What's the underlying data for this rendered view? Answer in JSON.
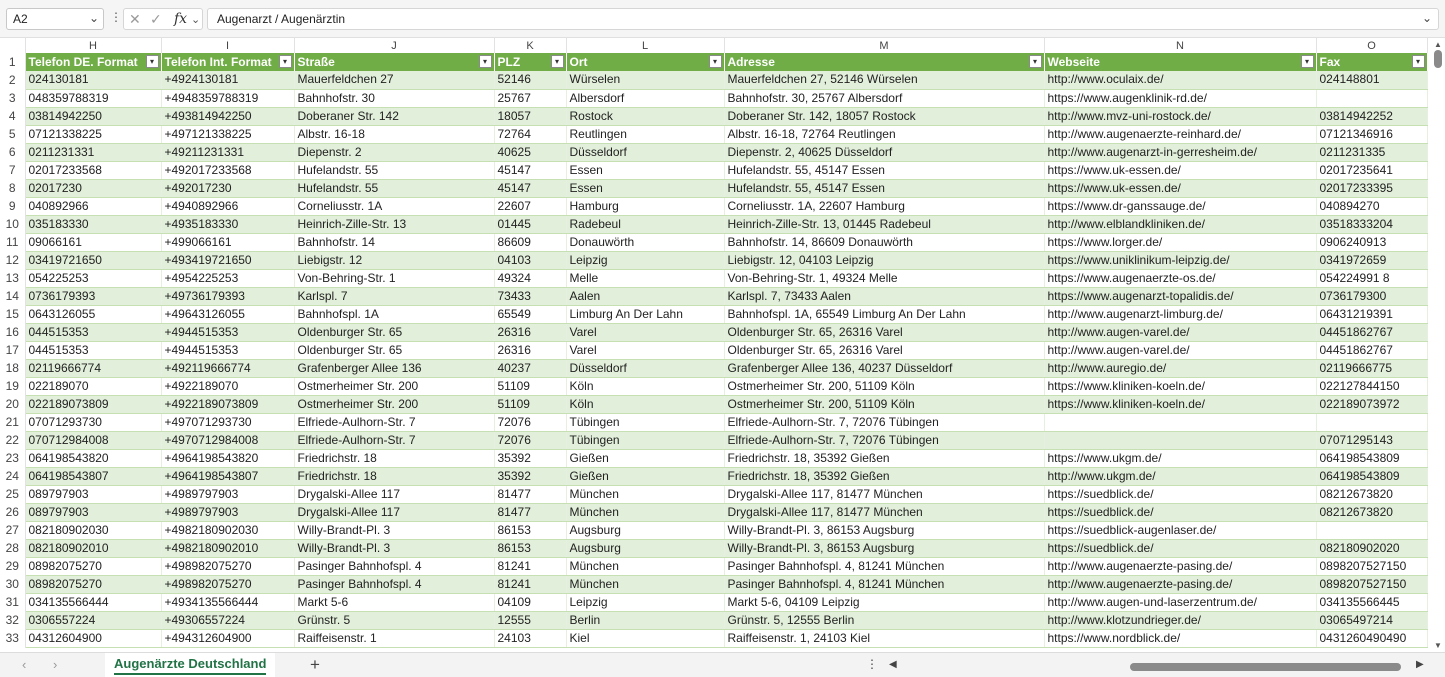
{
  "formula_bar": {
    "name_box": "A2",
    "fx_label": "fx",
    "cancel_glyph": "✕",
    "confirm_glyph": "✓",
    "formula": "Augenarzt / Augenärztin"
  },
  "grid": {
    "column_letters": [
      "H",
      "I",
      "J",
      "K",
      "L",
      "M",
      "N",
      "O"
    ],
    "headers": [
      "Telefon DE. Format",
      "Telefon Int. Format",
      "Straße",
      "PLZ",
      "Ort",
      "Adresse",
      "Webseite",
      "Fax"
    ],
    "filter_glyph": "▾",
    "header_row_number": "1",
    "rows": [
      {
        "n": "2",
        "c": [
          "024130181",
          "+4924130181",
          "Mauerfeldchen 27",
          "52146",
          "Würselen",
          "Mauerfeldchen 27, 52146 Würselen",
          "http://www.oculaix.de/",
          "024148801"
        ]
      },
      {
        "n": "3",
        "c": [
          "048359788319",
          "+4948359788319",
          "Bahnhofstr. 30",
          "25767",
          "Albersdorf",
          "Bahnhofstr. 30, 25767 Albersdorf",
          "https://www.augenklinik-rd.de/",
          ""
        ]
      },
      {
        "n": "4",
        "c": [
          "03814942250",
          "+493814942250",
          "Doberaner Str. 142",
          "18057",
          "Rostock",
          "Doberaner Str. 142, 18057 Rostock",
          "http://www.mvz-uni-rostock.de/",
          "03814942252"
        ]
      },
      {
        "n": "5",
        "c": [
          "07121338225",
          "+497121338225",
          "Albstr. 16-18",
          "72764",
          "Reutlingen",
          "Albstr. 16-18, 72764 Reutlingen",
          "http://www.augenaerzte-reinhard.de/",
          "07121346916"
        ]
      },
      {
        "n": "6",
        "c": [
          "0211231331",
          "+49211231331",
          "Diepenstr. 2",
          "40625",
          "Düsseldorf",
          "Diepenstr. 2, 40625 Düsseldorf",
          "http://www.augenarzt-in-gerresheim.de/",
          "0211231335"
        ]
      },
      {
        "n": "7",
        "c": [
          "02017233568",
          "+492017233568",
          "Hufelandstr. 55",
          "45147",
          "Essen",
          "Hufelandstr. 55, 45147 Essen",
          "https://www.uk-essen.de/",
          "02017235641"
        ]
      },
      {
        "n": "8",
        "c": [
          "02017230",
          "+492017230",
          "Hufelandstr. 55",
          "45147",
          "Essen",
          "Hufelandstr. 55, 45147 Essen",
          "https://www.uk-essen.de/",
          "02017233395"
        ]
      },
      {
        "n": "9",
        "c": [
          "040892966",
          "+4940892966",
          "Corneliusstr. 1A",
          "22607",
          "Hamburg",
          "Corneliusstr. 1A, 22607 Hamburg",
          "https://www.dr-ganssauge.de/",
          "040894270"
        ]
      },
      {
        "n": "10",
        "c": [
          "035183330",
          "+4935183330",
          "Heinrich-Zille-Str. 13",
          "01445",
          "Radebeul",
          "Heinrich-Zille-Str. 13, 01445 Radebeul",
          "http://www.elblandkliniken.de/",
          "03518333204"
        ]
      },
      {
        "n": "11",
        "c": [
          "09066161",
          "+499066161",
          "Bahnhofstr. 14",
          "86609",
          "Donauwörth",
          "Bahnhofstr. 14, 86609 Donauwörth",
          "https://www.lorger.de/",
          "0906240913"
        ]
      },
      {
        "n": "12",
        "c": [
          "03419721650",
          "+493419721650",
          "Liebigstr. 12",
          "04103",
          "Leipzig",
          "Liebigstr. 12, 04103 Leipzig",
          "https://www.uniklinikum-leipzig.de/",
          "0341972659"
        ]
      },
      {
        "n": "13",
        "c": [
          "054225253",
          "+4954225253",
          "Von-Behring-Str. 1",
          "49324",
          "Melle",
          "Von-Behring-Str. 1, 49324 Melle",
          "https://www.augenaerzte-os.de/",
          "054224991 8"
        ]
      },
      {
        "n": "14",
        "c": [
          "0736179393",
          "+49736179393",
          "Karlspl. 7",
          "73433",
          "Aalen",
          "Karlspl. 7, 73433 Aalen",
          "https://www.augenarzt-topalidis.de/",
          "0736179300"
        ]
      },
      {
        "n": "15",
        "c": [
          "0643126055",
          "+49643126055",
          "Bahnhofspl. 1A",
          "65549",
          "Limburg An Der Lahn",
          "Bahnhofspl. 1A, 65549 Limburg An Der Lahn",
          "http://www.augenarzt-limburg.de/",
          "06431219391"
        ]
      },
      {
        "n": "16",
        "c": [
          "044515353",
          "+4944515353",
          "Oldenburger Str. 65",
          "26316",
          "Varel",
          "Oldenburger Str. 65, 26316 Varel",
          "http://www.augen-varel.de/",
          "04451862767"
        ]
      },
      {
        "n": "17",
        "c": [
          "044515353",
          "+4944515353",
          "Oldenburger Str. 65",
          "26316",
          "Varel",
          "Oldenburger Str. 65, 26316 Varel",
          "http://www.augen-varel.de/",
          "04451862767"
        ]
      },
      {
        "n": "18",
        "c": [
          "02119666774",
          "+492119666774",
          "Grafenberger Allee 136",
          "40237",
          "Düsseldorf",
          "Grafenberger Allee 136, 40237 Düsseldorf",
          "http://www.auregio.de/",
          "02119666775"
        ]
      },
      {
        "n": "19",
        "c": [
          "022189070",
          "+4922189070",
          "Ostmerheimer Str. 200",
          "51109",
          "Köln",
          "Ostmerheimer Str. 200, 51109 Köln",
          "https://www.kliniken-koeln.de/",
          "022127844150"
        ]
      },
      {
        "n": "20",
        "c": [
          "022189073809",
          "+4922189073809",
          "Ostmerheimer Str. 200",
          "51109",
          "Köln",
          "Ostmerheimer Str. 200, 51109 Köln",
          "https://www.kliniken-koeln.de/",
          "022189073972"
        ]
      },
      {
        "n": "21",
        "c": [
          "07071293730",
          "+497071293730",
          "Elfriede-Aulhorn-Str. 7",
          "72076",
          "Tübingen",
          "Elfriede-Aulhorn-Str. 7, 72076 Tübingen",
          "",
          ""
        ]
      },
      {
        "n": "22",
        "c": [
          "070712984008",
          "+4970712984008",
          "Elfriede-Aulhorn-Str. 7",
          "72076",
          "Tübingen",
          "Elfriede-Aulhorn-Str. 7, 72076 Tübingen",
          "",
          "07071295143"
        ]
      },
      {
        "n": "23",
        "c": [
          "064198543820",
          "+4964198543820",
          "Friedrichstr. 18",
          "35392",
          "Gießen",
          "Friedrichstr. 18, 35392 Gießen",
          "https://www.ukgm.de/",
          "064198543809"
        ]
      },
      {
        "n": "24",
        "c": [
          "064198543807",
          "+4964198543807",
          "Friedrichstr. 18",
          "35392",
          "Gießen",
          "Friedrichstr. 18, 35392 Gießen",
          "http://www.ukgm.de/",
          "064198543809"
        ]
      },
      {
        "n": "25",
        "c": [
          "089797903",
          "+4989797903",
          "Drygalski-Allee 117",
          "81477",
          "München",
          "Drygalski-Allee 117, 81477 München",
          "https://suedblick.de/",
          "08212673820"
        ]
      },
      {
        "n": "26",
        "c": [
          "089797903",
          "+4989797903",
          "Drygalski-Allee 117",
          "81477",
          "München",
          "Drygalski-Allee 117, 81477 München",
          "https://suedblick.de/",
          "08212673820"
        ]
      },
      {
        "n": "27",
        "c": [
          "082180902030",
          "+4982180902030",
          "Willy-Brandt-Pl. 3",
          "86153",
          "Augsburg",
          "Willy-Brandt-Pl. 3, 86153 Augsburg",
          "https://suedblick-augenlaser.de/",
          ""
        ]
      },
      {
        "n": "28",
        "c": [
          "082180902010",
          "+4982180902010",
          "Willy-Brandt-Pl. 3",
          "86153",
          "Augsburg",
          "Willy-Brandt-Pl. 3, 86153 Augsburg",
          "https://suedblick.de/",
          "082180902020"
        ]
      },
      {
        "n": "29",
        "c": [
          "08982075270",
          "+498982075270",
          "Pasinger Bahnhofspl. 4",
          "81241",
          "München",
          "Pasinger Bahnhofspl. 4, 81241 München",
          "http://www.augenaerzte-pasing.de/",
          "0898207527150"
        ]
      },
      {
        "n": "30",
        "c": [
          "08982075270",
          "+498982075270",
          "Pasinger Bahnhofspl. 4",
          "81241",
          "München",
          "Pasinger Bahnhofspl. 4, 81241 München",
          "http://www.augenaerzte-pasing.de/",
          "0898207527150"
        ]
      },
      {
        "n": "31",
        "c": [
          "034135566444",
          "+4934135566444",
          "Markt 5-6",
          "04109",
          "Leipzig",
          "Markt 5-6, 04109 Leipzig",
          "http://www.augen-und-laserzentrum.de/",
          "034135566445"
        ]
      },
      {
        "n": "32",
        "c": [
          "0306557224",
          "+49306557224",
          "Grünstr. 5",
          "12555",
          "Berlin",
          "Grünstr. 5, 12555 Berlin",
          "http://www.klotzundrieger.de/",
          "03065497214"
        ]
      },
      {
        "n": "33",
        "c": [
          "04312604900",
          "+494312604900",
          "Raiffeisenstr. 1",
          "24103",
          "Kiel",
          "Raiffeisenstr. 1, 24103 Kiel",
          "https://www.nordblick.de/",
          "0431260490490"
        ]
      }
    ]
  },
  "sheet_tabs": {
    "active": "Augenärzte Deutschland",
    "add_glyph": "+",
    "prev_glyph": "‹",
    "next_glyph": "›",
    "options_glyph": "⋮"
  },
  "colors": {
    "header_fill": "#70ad47",
    "band_fill": "#e2efda",
    "accent": "#217346"
  }
}
